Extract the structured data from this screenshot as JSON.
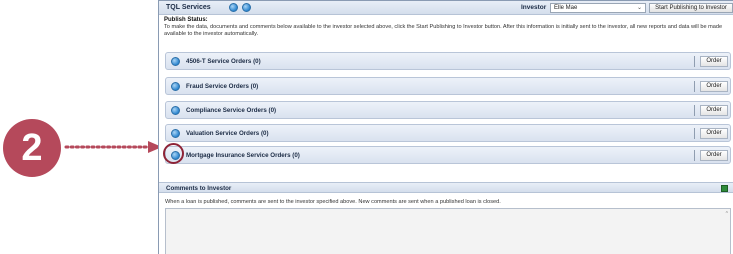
{
  "callout": {
    "number": "2"
  },
  "header": {
    "title": "TQL Services",
    "investor_label": "Investor",
    "investor_value": "Elle Mae",
    "caret": "⌄",
    "publish_button": "Start Publishing to Investor"
  },
  "publish": {
    "status_label": "Publish Status:",
    "description": "To make the data, documents and comments below available to the investor selected above, click the Start Publishing to Investor button. After this information is initially sent to the investor, all new reports and data will be made available to the investor automatically."
  },
  "orders": [
    {
      "label": "4506-T Service Orders (0)",
      "button": "Order"
    },
    {
      "label": "Fraud Service Orders (0)",
      "button": "Order"
    },
    {
      "label": "Compliance Service Orders (0)",
      "button": "Order"
    },
    {
      "label": "Valuation Service Orders (0)",
      "button": "Order"
    },
    {
      "label": "Mortgage Insurance Service Orders (0)",
      "button": "Order"
    }
  ],
  "comments": {
    "title": "Comments to Investor",
    "description": "When a loan is published, comments are sent to the investor specified above. New comments are sent when a published loan is closed.",
    "value": ""
  },
  "icons": {
    "header": [
      "expand-icon",
      "collapse-icon"
    ],
    "row": "expand-icon",
    "export": "export-icon"
  },
  "colors": {
    "callout": "#b5495b",
    "highlight": "#8e2437",
    "accent": "#2d86cf",
    "header_bg": "#d4deec"
  }
}
